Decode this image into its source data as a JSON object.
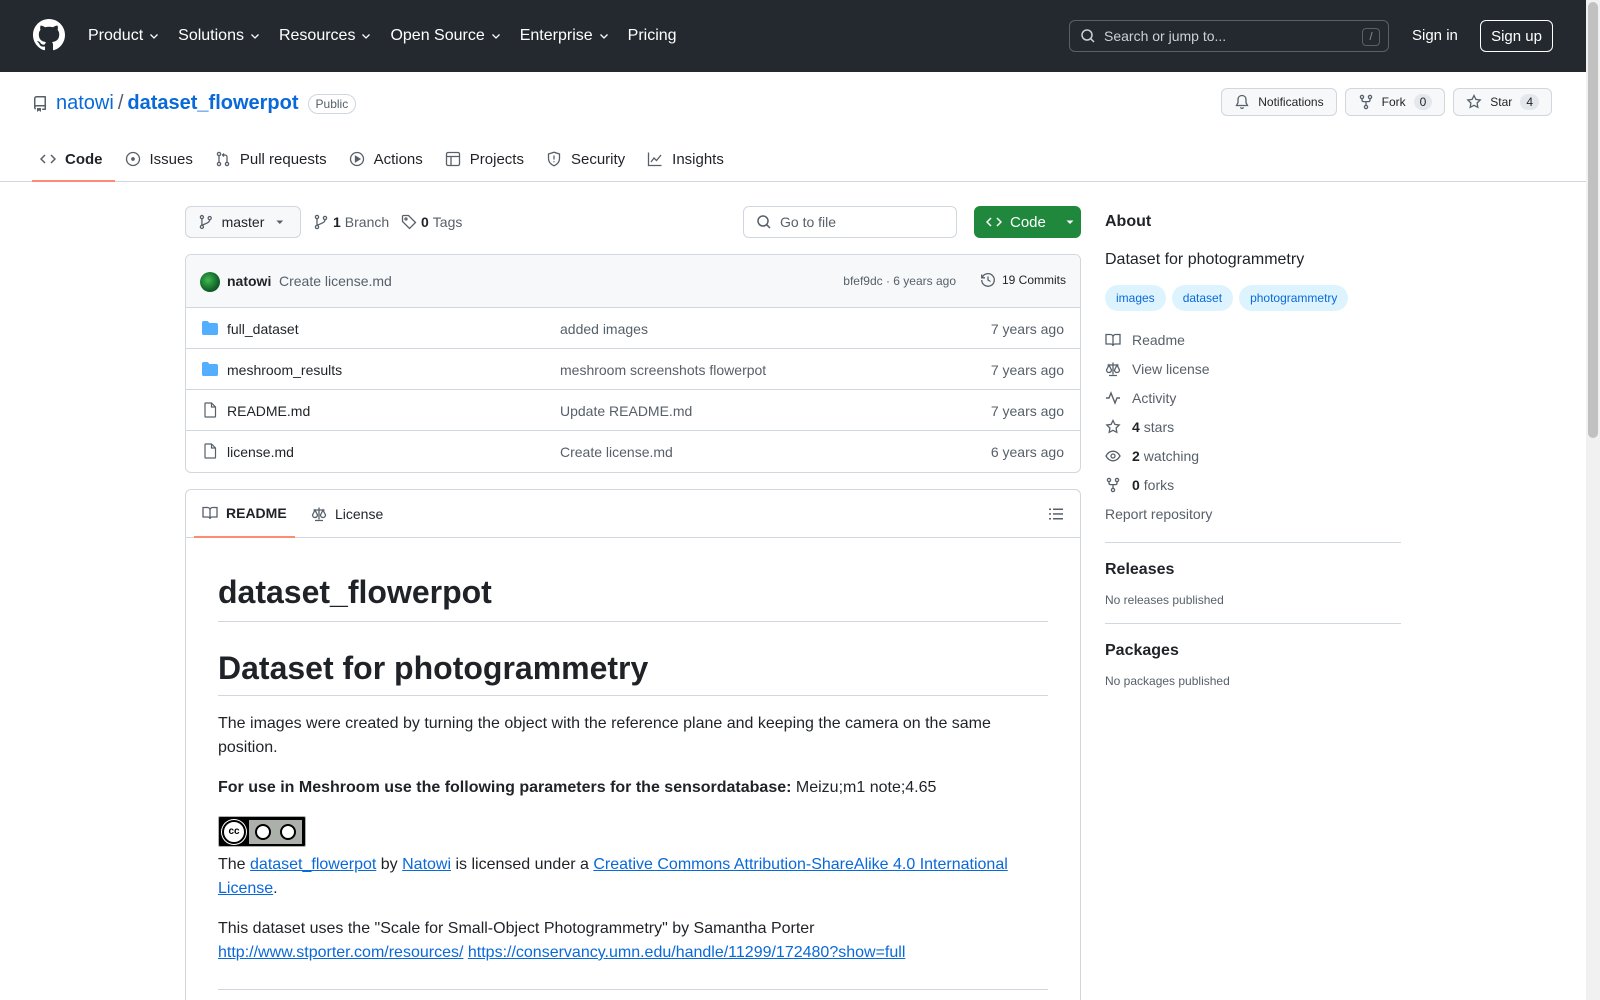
{
  "header": {
    "nav": [
      "Product",
      "Solutions",
      "Resources",
      "Open Source",
      "Enterprise",
      "Pricing"
    ],
    "search_placeholder": "Search or jump to...",
    "search_shortcut": "/",
    "signin": "Sign in",
    "signup": "Sign up"
  },
  "repo": {
    "owner": "natowi",
    "separator": "/",
    "name": "dataset_flowerpot",
    "visibility": "Public",
    "notifications_label": "Notifications",
    "fork_label": "Fork",
    "fork_count": "0",
    "star_label": "Star",
    "star_count": "4"
  },
  "tabs": [
    "Code",
    "Issues",
    "Pull requests",
    "Actions",
    "Projects",
    "Security",
    "Insights"
  ],
  "branch_bar": {
    "branch": "master",
    "branch_count": "1",
    "branch_label": "Branch",
    "tag_count": "0",
    "tag_label": "Tags",
    "gofile_placeholder": "Go to file",
    "code_button": "Code"
  },
  "commit": {
    "author": "natowi",
    "message": "Create license.md",
    "sha_time": "bfef9dc · 6 years ago",
    "count_label": "19 Commits"
  },
  "files": [
    {
      "name": "full_dataset",
      "type": "folder",
      "message": "added images",
      "age": "7 years ago"
    },
    {
      "name": "meshroom_results",
      "type": "folder",
      "message": "meshroom screenshots flowerpot",
      "age": "7 years ago"
    },
    {
      "name": "README.md",
      "type": "file",
      "message": "Update README.md",
      "age": "7 years ago"
    },
    {
      "name": "license.md",
      "type": "file",
      "message": "Create license.md",
      "age": "6 years ago"
    }
  ],
  "readme": {
    "tab_readme": "README",
    "tab_license": "License",
    "h1": "dataset_flowerpot",
    "h1b": "Dataset for photogrammetry",
    "p1": "The images were created by turning the object with the reference plane and keeping the camera on the same position.",
    "p2_bold": "For use in Meshroom use the following parameters for the sensordatabase:",
    "p2_rest": " Meizu;m1 note;4.65",
    "cc_badge_text": "cc by sa",
    "p3_the": "The ",
    "p3_link1": "dataset_flowerpot",
    "p3_by": " by ",
    "p3_link2": "Natowi",
    "p3_licensed": " is licensed under a ",
    "p3_link3": "Creative Commons Attribution-ShareAlike 4.0 International License",
    "p3_end": ".",
    "p4": "This dataset uses the \"Scale for Small-Object Photogrammetry\" by Samantha Porter",
    "p4_link1": "http://www.stporter.com/resources/",
    "p4_space": " ",
    "p4_link2": "https://conservancy.umn.edu/handle/11299/172480?show=full"
  },
  "about": {
    "title": "About",
    "description": "Dataset for photogrammetry",
    "topics": [
      "images",
      "dataset",
      "photogrammetry"
    ],
    "readme_link": "Readme",
    "license_link": "View license",
    "activity_link": "Activity",
    "stars_count": "4",
    "stars_label": "stars",
    "watching_count": "2",
    "watching_label": "watching",
    "forks_count": "0",
    "forks_label": "forks",
    "report": "Report repository"
  },
  "releases": {
    "title": "Releases",
    "empty": "No releases published"
  },
  "packages": {
    "title": "Packages",
    "empty": "No packages published"
  },
  "colors": {
    "header_bg": "#24292f",
    "accent_link": "#0969da",
    "code_button": "#1f883d",
    "active_tab_underline": "#fd8c73",
    "topic_bg": "#ddf4ff"
  }
}
